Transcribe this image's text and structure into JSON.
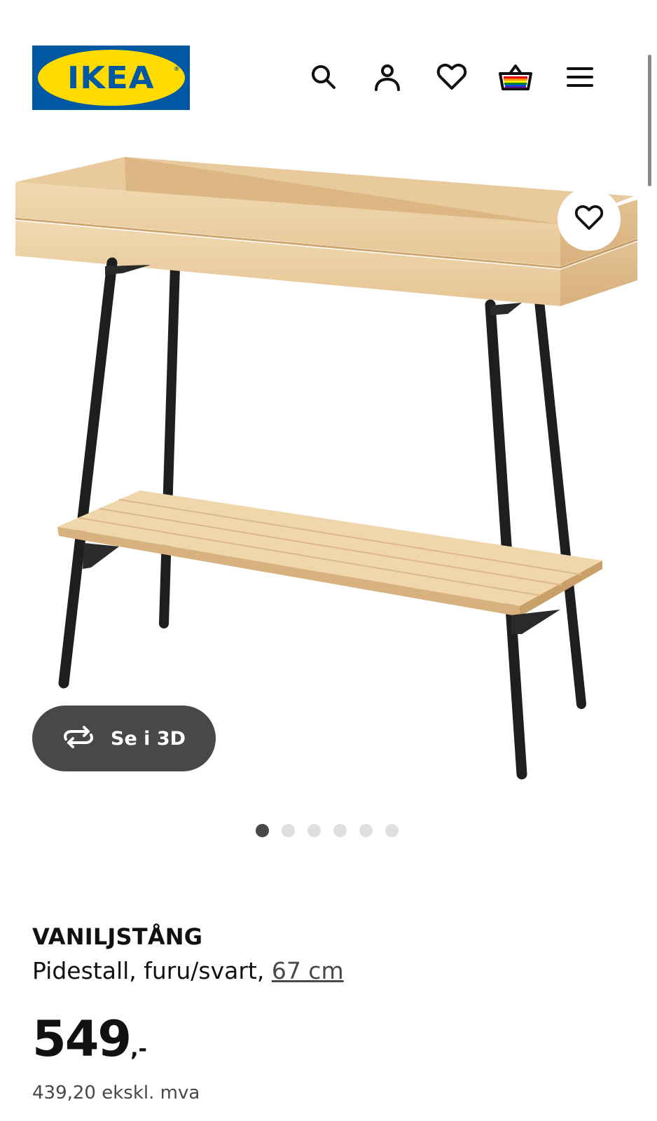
{
  "header": {
    "logo_text": "IKEA",
    "logo_mark": "®",
    "icons": [
      "search-icon",
      "account-icon",
      "favourites-heart-icon",
      "shopping-bag-icon",
      "menu-hamburger-icon"
    ]
  },
  "colors": {
    "ikea_blue": "#0058a3",
    "ikea_yellow": "#ffdb00",
    "button_dark": "#484848",
    "dot_inactive": "#dfdfdf",
    "text": "#111111"
  },
  "gallery": {
    "fav_icon": "heart-outline-icon",
    "view3d_label": "Se i 3D",
    "view3d_icon": "rotate-3d-icon",
    "dot_count": 6,
    "active_dot": 1
  },
  "product": {
    "name": "VANILJSTÅNG",
    "description": "Pidestall, furu/svart, ",
    "size_link": "67 cm",
    "price_integer": "549",
    "price_suffix": ",-",
    "price_ex_vat": "439,20 ekskl. mva"
  }
}
